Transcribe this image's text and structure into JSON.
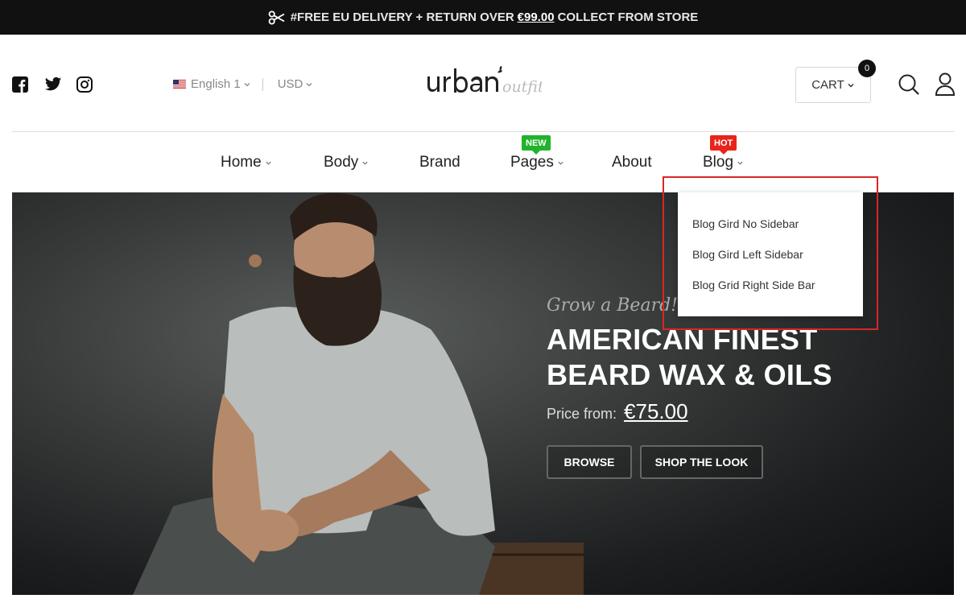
{
  "promo": {
    "text_before": "#FREE EU DELIVERY + RETURN OVER",
    "amount": "€99.00",
    "text_after": "COLLECT FROM STORE"
  },
  "header": {
    "language": "English 1",
    "currency": "USD",
    "cart_label": "CART",
    "cart_count": "0"
  },
  "nav": {
    "items": [
      {
        "label": "Home"
      },
      {
        "label": "Body"
      },
      {
        "label": "Brand"
      },
      {
        "label": "Pages",
        "badge": "NEW"
      },
      {
        "label": "About"
      },
      {
        "label": "Blog",
        "badge": "HOT"
      }
    ]
  },
  "dropdown": {
    "items": [
      "Blog Gird No Sidebar",
      "Blog Gird Left Sidebar",
      "Blog Grid Right Side Bar"
    ]
  },
  "hero": {
    "script": "Grow a Beard!",
    "headline_line1": "AMERICAN FINEST",
    "headline_line2": "BEARD WAX & OILS",
    "price_label": "Price from:",
    "price": "€75.00",
    "browse_label": "BROWSE",
    "shop_label": "SHOP THE LOOK"
  },
  "colors": {
    "promo_bg": "#111111",
    "new_badge": "#21b32b",
    "hot_badge": "#e8241b",
    "highlight": "#d92626"
  }
}
